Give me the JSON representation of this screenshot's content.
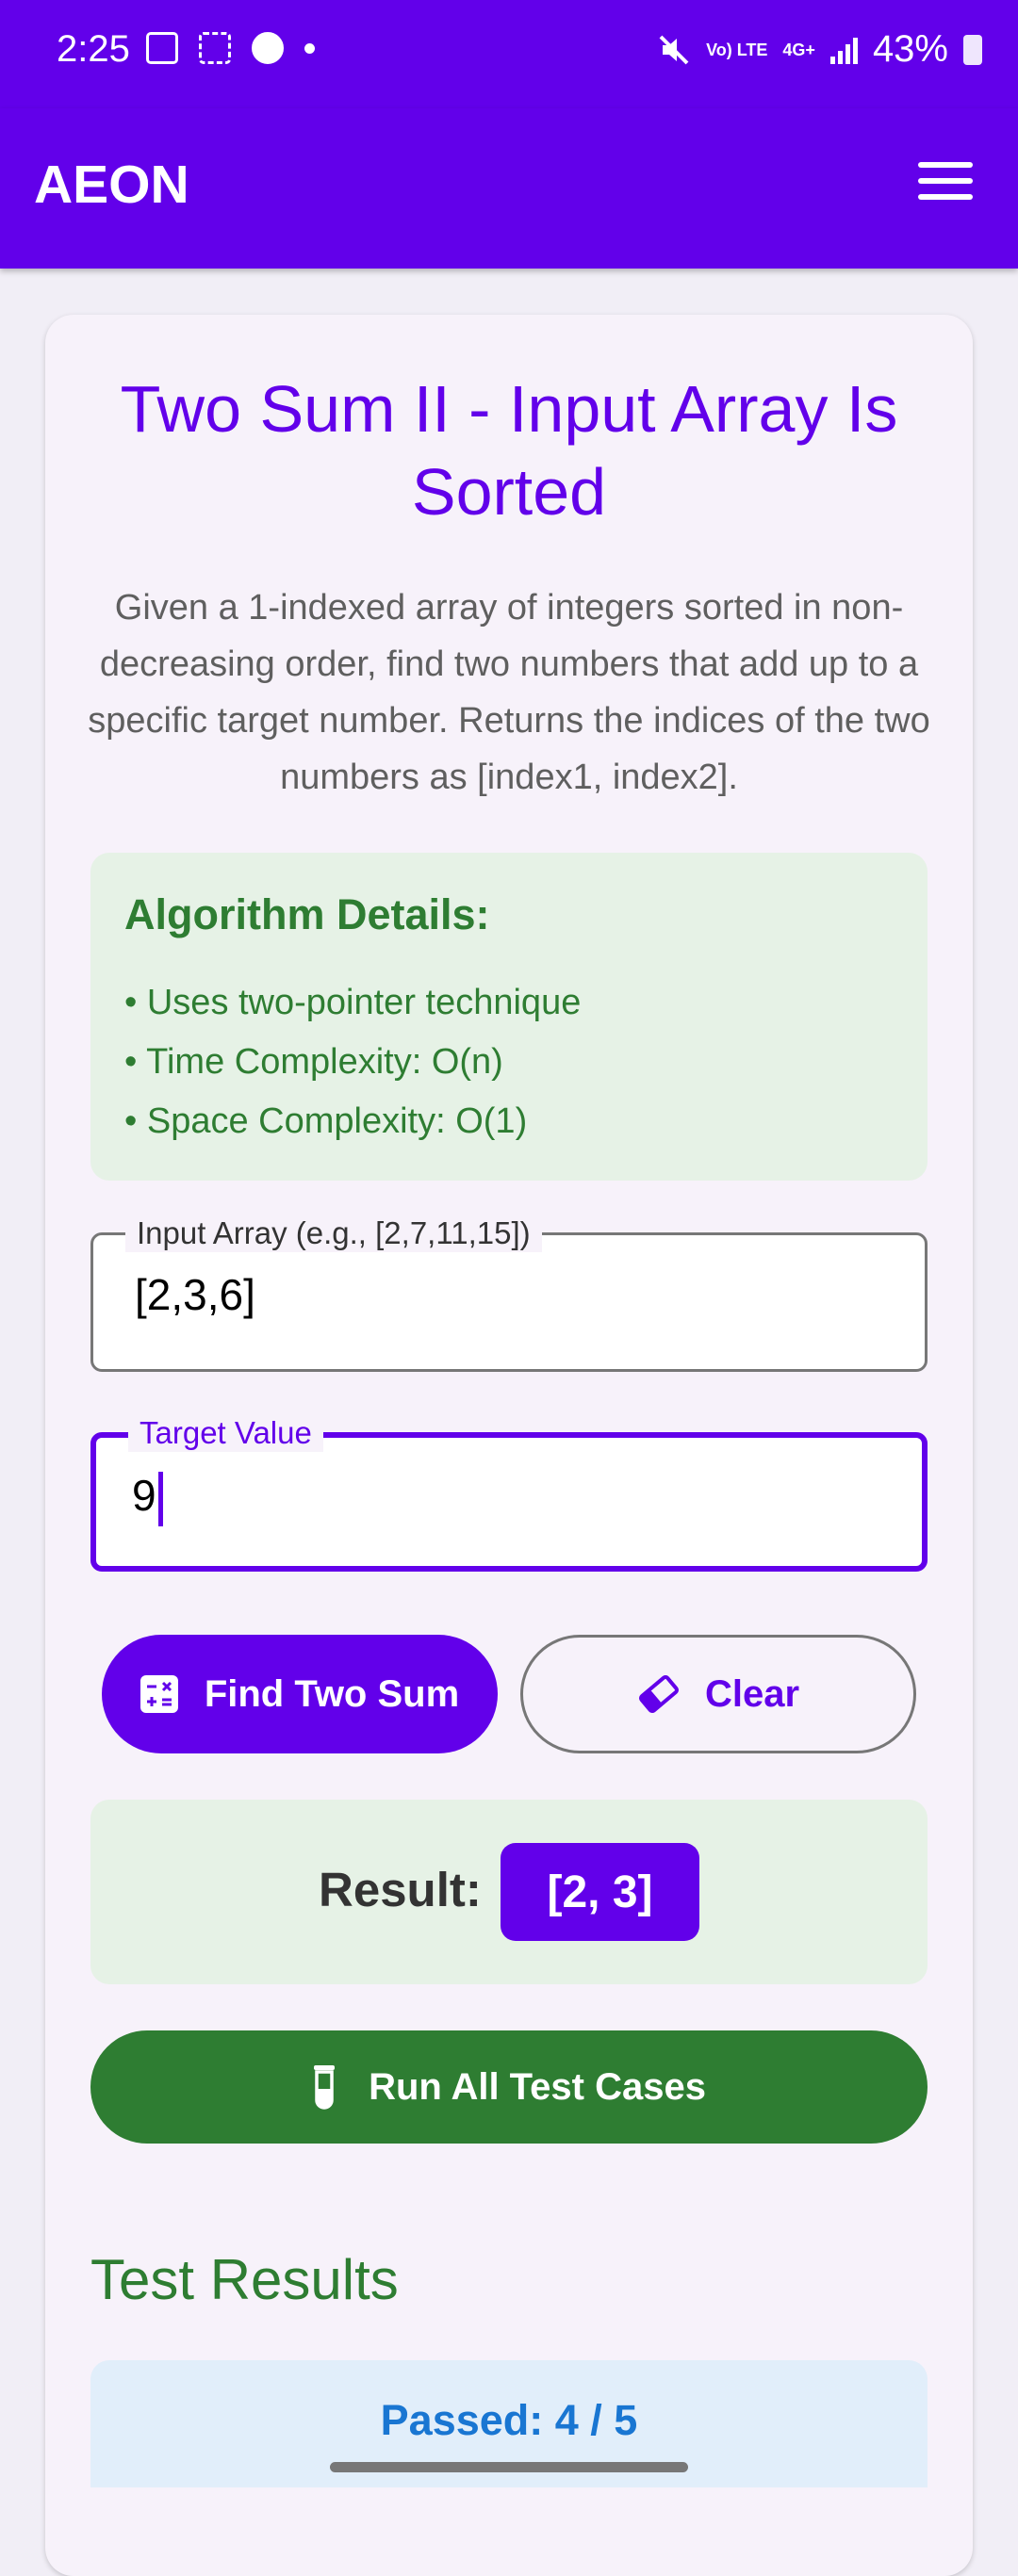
{
  "status_bar": {
    "time": "2:25",
    "battery": "43%",
    "network": "4G+",
    "volte": "Vo) LTE",
    "icons": [
      "image-icon",
      "screenshot-icon",
      "app-badge-icon",
      "dot-icon",
      "mute-icon",
      "signal-icon",
      "battery-icon"
    ]
  },
  "app_bar": {
    "title": "AEON",
    "menu_icon": "hamburger-menu-icon"
  },
  "problem": {
    "title": "Two Sum II - Input Array Is Sorted",
    "description": "Given a 1-indexed array of integers sorted in non-decreasing order, find two numbers that add up to a specific target number. Returns the indices of the two numbers as [index1, index2]."
  },
  "algorithm": {
    "heading": "Algorithm Details:",
    "items": [
      "• Uses two-pointer technique",
      "• Time Complexity: O(n)",
      "• Space Complexity: O(1)"
    ]
  },
  "inputs": {
    "array_label": "Input Array (e.g., [2,7,11,15])",
    "array_value": "[2,3,6]",
    "target_label": "Target Value",
    "target_value": "9"
  },
  "buttons": {
    "find_label": "Find Two Sum",
    "clear_label": "Clear",
    "run_tests_label": "Run All Test Cases"
  },
  "result": {
    "label": "Result:",
    "value": "[2, 3]"
  },
  "tests": {
    "heading": "Test Results",
    "passed": "Passed: 4 / 5"
  },
  "colors": {
    "primary": "#6200ea",
    "success": "#2e7d32",
    "info": "#1976d2"
  }
}
